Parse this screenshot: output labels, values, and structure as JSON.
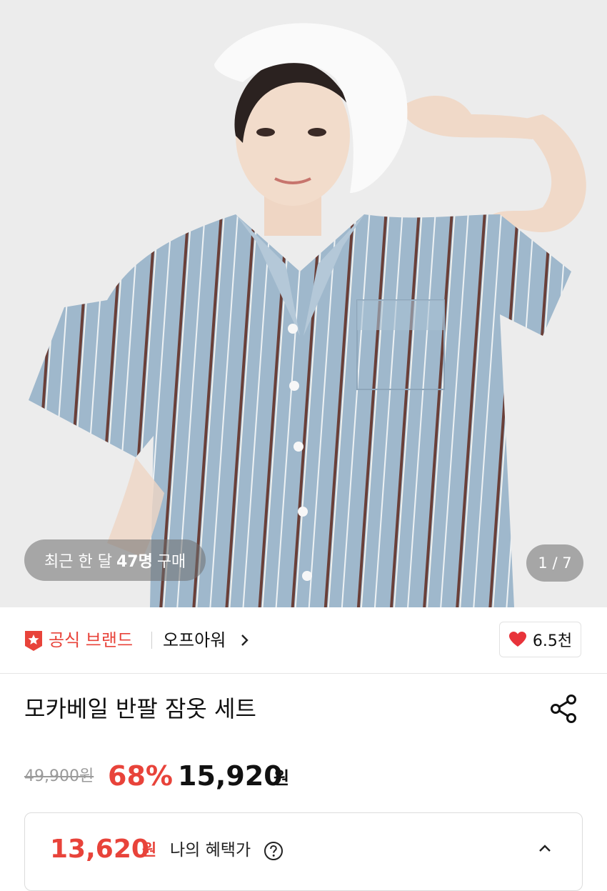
{
  "hero": {
    "recent_prefix": "최근 한 달 ",
    "recent_count": "47명",
    "recent_suffix": " 구매",
    "image_counter": "1 / 7"
  },
  "brand": {
    "badge_label": "공식 브랜드",
    "name": "오프아워",
    "like_count": "6.5천"
  },
  "product": {
    "title": "모카베일 반팔 잠옷 세트",
    "original_price": "49,900원",
    "discount": "68%",
    "price": "15,920",
    "price_unit": "원"
  },
  "benefit": {
    "price": "13,620",
    "unit": "원",
    "label": "나의 혜택가"
  },
  "colors": {
    "accent": "#e8433a",
    "shirt": "#9fb8cc",
    "stripe": "#6a3f38"
  },
  "icons": [
    "official-badge-icon",
    "chevron-right-icon",
    "heart-icon",
    "share-icon",
    "question-icon",
    "chevron-up-icon"
  ]
}
